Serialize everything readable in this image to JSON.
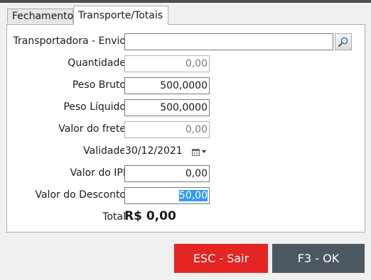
{
  "tabs": {
    "fechamento": "Fechamento",
    "transporte": "Transporte/Totais"
  },
  "form": {
    "transportadora": {
      "label": "Transportadora - Envio",
      "value": ""
    },
    "quantidade": {
      "label": "Quantidade",
      "value": "0,00"
    },
    "peso_bruto": {
      "label": "Peso Bruto",
      "value": "500,0000"
    },
    "peso_liquido": {
      "label": "Peso Líquido",
      "value": "500,0000"
    },
    "valor_frete": {
      "label": "Valor do frete",
      "value": "0,00"
    },
    "validade": {
      "label": "Validade",
      "value": "30/12/2021"
    },
    "valor_ipi": {
      "label": "Valor do IPI",
      "value": "0,00"
    },
    "valor_desconto": {
      "label": "Valor do Desconto",
      "value": "50,00"
    },
    "total": {
      "label": "Total",
      "value": "R$ 0,00"
    }
  },
  "icons": {
    "search": "search-icon",
    "calendar": "calendar-icon",
    "dropdown": "chevron-down-icon"
  },
  "buttons": {
    "esc": "ESC - Sair",
    "ok": "F3 - OK"
  },
  "colors": {
    "esc_button": "#e52424",
    "ok_button": "#4c5761",
    "selection": "#3399ff"
  }
}
